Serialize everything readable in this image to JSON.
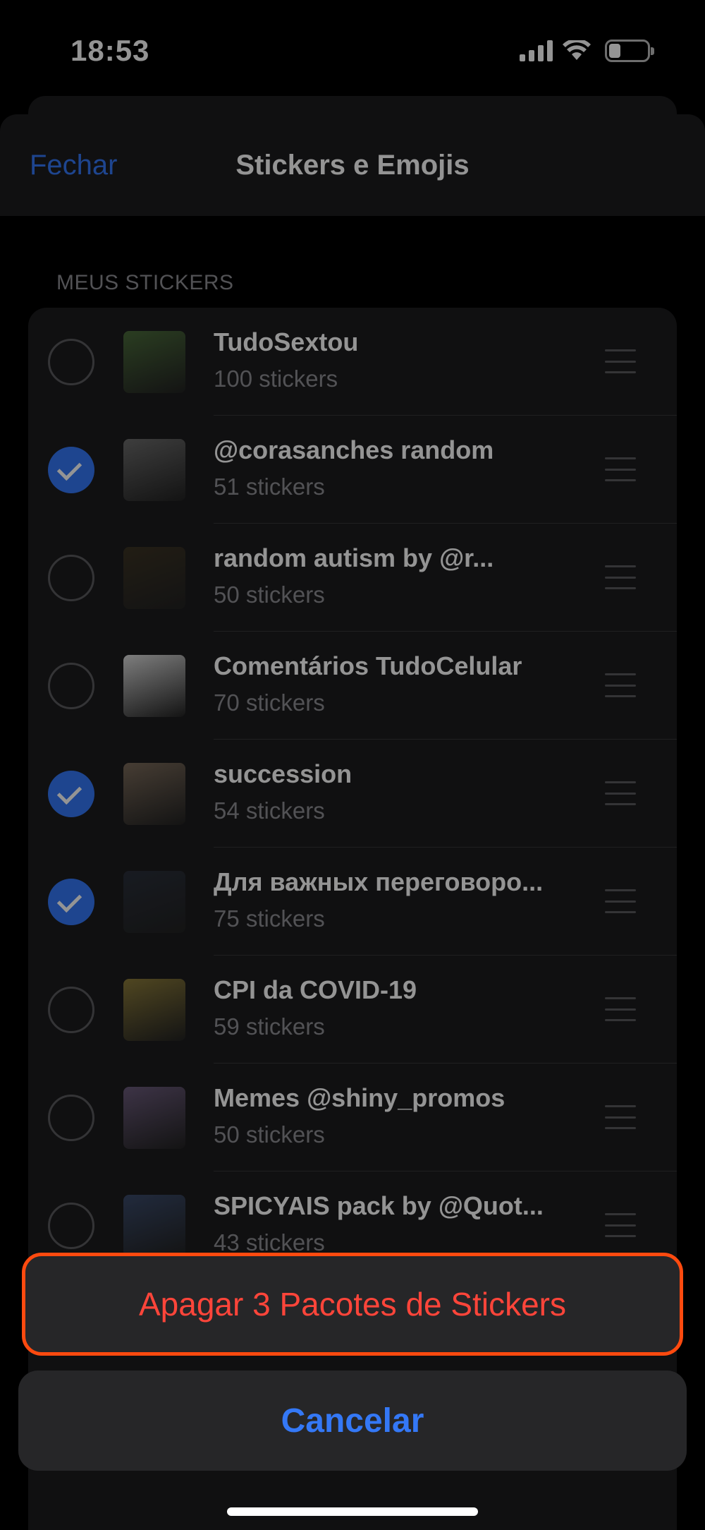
{
  "status_bar": {
    "time": "18:53"
  },
  "nav": {
    "close_label": "Fechar",
    "title": "Stickers e Emojis"
  },
  "section": {
    "header": "MEUS STICKERS"
  },
  "packs": [
    {
      "title": "TudoSextou",
      "count": "100 stickers",
      "selected": false,
      "thumb_color": "#4a6a3a"
    },
    {
      "title": "@corasanches random",
      "count": "51 stickers",
      "selected": true,
      "thumb_color": "#6b6b6b"
    },
    {
      "title": "random autism         by @r...",
      "count": "50 stickers",
      "selected": false,
      "thumb_color": "#3b3324"
    },
    {
      "title": "Comentários TudoCelular",
      "count": "70 stickers",
      "selected": false,
      "thumb_color": "#d9d9d9"
    },
    {
      "title": "succession",
      "count": "54 stickers",
      "selected": true,
      "thumb_color": "#7a6a5a"
    },
    {
      "title": "Для важных переговоро...",
      "count": "75 stickers",
      "selected": true,
      "thumb_color": "#2a2f3a"
    },
    {
      "title": "CPI da COVID-19",
      "count": "59 stickers",
      "selected": false,
      "thumb_color": "#8a7a3a"
    },
    {
      "title": "Memes @shiny_promos",
      "count": "50 stickers",
      "selected": false,
      "thumb_color": "#6a5a7a"
    },
    {
      "title": "SPICYAIS pack by @Quot...",
      "count": "43 stickers",
      "selected": false,
      "thumb_color": "#3a4a6a"
    }
  ],
  "action_sheet": {
    "delete_label": "Apagar 3 Pacotes de Stickers",
    "cancel_label": "Cancelar"
  }
}
